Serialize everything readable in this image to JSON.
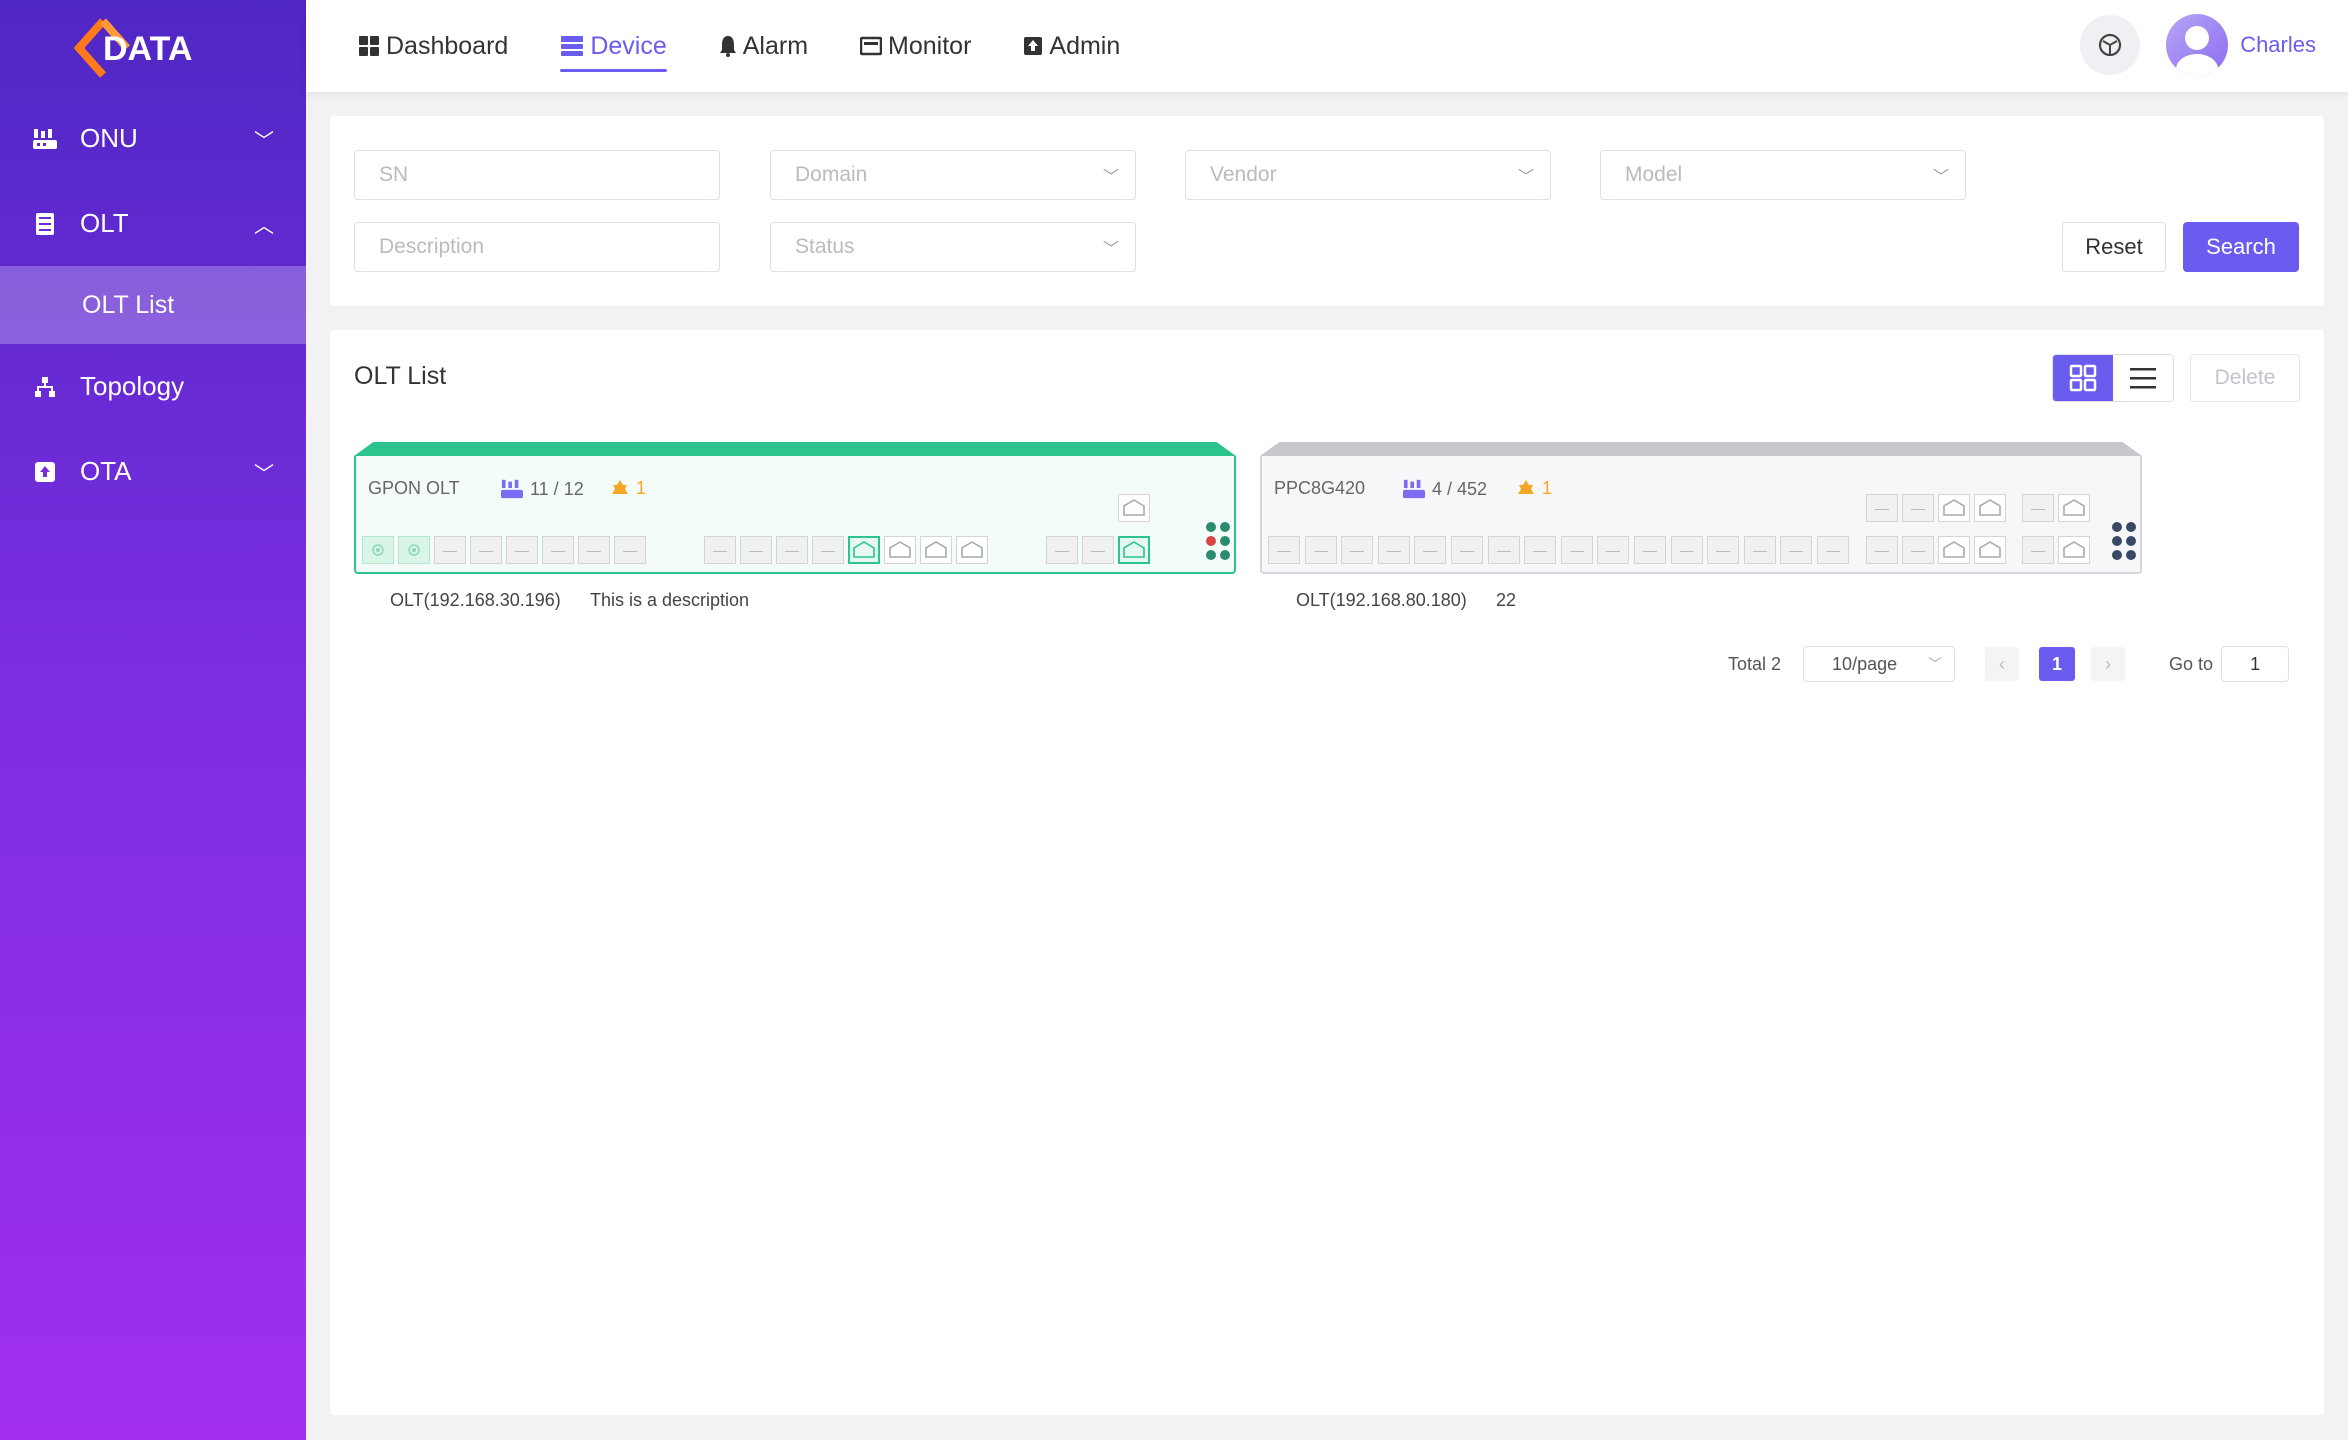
{
  "brand": {
    "logo_text": "DATA"
  },
  "sidebar": {
    "items": [
      {
        "label": "ONU",
        "icon": "onu-icon",
        "expanded": false
      },
      {
        "label": "OLT",
        "icon": "olt-icon",
        "expanded": true,
        "children": [
          {
            "label": "OLT List",
            "active": true
          }
        ]
      },
      {
        "label": "Topology",
        "icon": "topology-icon",
        "expanded": false
      },
      {
        "label": "OTA",
        "icon": "ota-icon",
        "expanded": false
      }
    ]
  },
  "topnav": {
    "tabs": [
      {
        "label": "Dashboard",
        "icon": "dashboard-icon",
        "active": false
      },
      {
        "label": "Device",
        "icon": "device-icon",
        "active": true
      },
      {
        "label": "Alarm",
        "icon": "alarm-icon",
        "active": false
      },
      {
        "label": "Monitor",
        "icon": "monitor-icon",
        "active": false
      },
      {
        "label": "Admin",
        "icon": "admin-icon",
        "active": false
      }
    ],
    "user": {
      "name": "Charles"
    }
  },
  "filters": {
    "sn": {
      "placeholder": "SN",
      "value": ""
    },
    "domain": {
      "placeholder": "Domain"
    },
    "vendor": {
      "placeholder": "Vendor"
    },
    "model": {
      "placeholder": "Model"
    },
    "description": {
      "placeholder": "Description",
      "value": ""
    },
    "status": {
      "placeholder": "Status"
    },
    "reset_label": "Reset",
    "search_label": "Search"
  },
  "olt_list": {
    "title": "OLT List",
    "delete_label": "Delete",
    "view_mode": "grid",
    "devices": [
      {
        "name": "GPON OLT",
        "onu_count": "11 / 12",
        "alarm_count": "1",
        "online": true,
        "address": "OLT(192.168.30.196)",
        "description": "This is a description"
      },
      {
        "name": "PPC8G420",
        "onu_count": "4 / 452",
        "alarm_count": "1",
        "online": false,
        "address": "OLT(192.168.80.180)",
        "description": "22"
      }
    ]
  },
  "pagination": {
    "total_label": "Total 2",
    "page_size": "10/page",
    "current_page": "1",
    "goto_label": "Go to",
    "goto_value": "1"
  },
  "colors": {
    "accent": "#6b5cf0",
    "online": "#2cc38c",
    "offline": "#c8c8cc",
    "alarm": "#f5a623"
  }
}
